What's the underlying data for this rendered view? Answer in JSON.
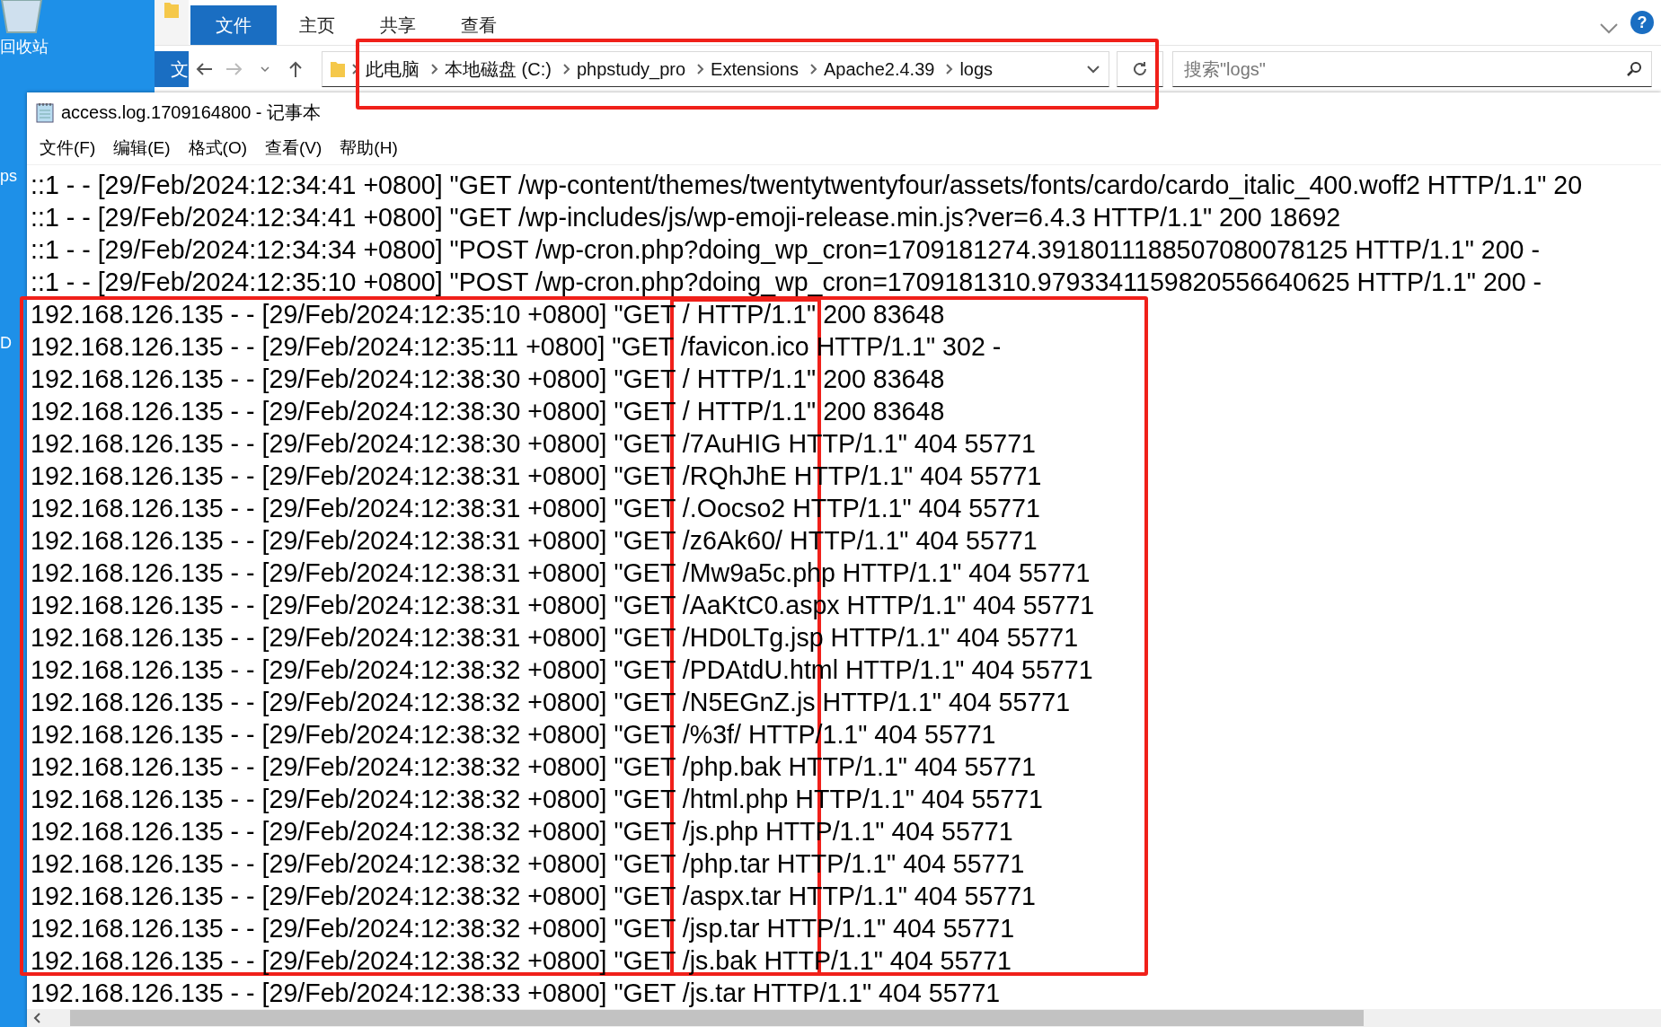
{
  "desktop": {
    "labels": [
      "回收站",
      "ps",
      "D"
    ]
  },
  "explorer": {
    "quick_access_label": "文",
    "ribbon_tabs": [
      {
        "label": "文件",
        "selected": true
      },
      {
        "label": "主页",
        "selected": false
      },
      {
        "label": "共享",
        "selected": false
      },
      {
        "label": "查看",
        "selected": false
      }
    ],
    "breadcrumb": [
      "此电脑",
      "本地磁盘 (C:)",
      "phpstudy_pro",
      "Extensions",
      "Apache2.4.39",
      "logs"
    ],
    "search": {
      "placeholder": "搜索\"logs\""
    },
    "help": "?"
  },
  "notepad": {
    "title": "access.log.1709164800 - 记事本",
    "menu": [
      "文件(F)",
      "编辑(E)",
      "格式(O)",
      "查看(V)",
      "帮助(H)"
    ],
    "lines": [
      "::1 - - [29/Feb/2024:12:34:41 +0800] \"GET /wp-content/themes/twentytwentyfour/assets/fonts/cardo/cardo_italic_400.woff2 HTTP/1.1\" 20",
      "::1 - - [29/Feb/2024:12:34:41 +0800] \"GET /wp-includes/js/wp-emoji-release.min.js?ver=6.4.3 HTTP/1.1\" 200 18692",
      "::1 - - [29/Feb/2024:12:34:34 +0800] \"POST /wp-cron.php?doing_wp_cron=1709181274.3918011188507080078125 HTTP/1.1\" 200 -",
      "::1 - - [29/Feb/2024:12:35:10 +0800] \"POST /wp-cron.php?doing_wp_cron=1709181310.9793341159820556640625 HTTP/1.1\" 200 -",
      "192.168.126.135 - - [29/Feb/2024:12:35:10 +0800] \"GET / HTTP/1.1\" 200 83648",
      "192.168.126.135 - - [29/Feb/2024:12:35:11 +0800] \"GET /favicon.ico HTTP/1.1\" 302 -",
      "192.168.126.135 - - [29/Feb/2024:12:38:30 +0800] \"GET / HTTP/1.1\" 200 83648",
      "192.168.126.135 - - [29/Feb/2024:12:38:30 +0800] \"GET / HTTP/1.1\" 200 83648",
      "192.168.126.135 - - [29/Feb/2024:12:38:30 +0800] \"GET /7AuHIG HTTP/1.1\" 404 55771",
      "192.168.126.135 - - [29/Feb/2024:12:38:31 +0800] \"GET /RQhJhE HTTP/1.1\" 404 55771",
      "192.168.126.135 - - [29/Feb/2024:12:38:31 +0800] \"GET /.Oocso2 HTTP/1.1\" 404 55771",
      "192.168.126.135 - - [29/Feb/2024:12:38:31 +0800] \"GET /z6Ak60/ HTTP/1.1\" 404 55771",
      "192.168.126.135 - - [29/Feb/2024:12:38:31 +0800] \"GET /Mw9a5c.php HTTP/1.1\" 404 55771",
      "192.168.126.135 - - [29/Feb/2024:12:38:31 +0800] \"GET /AaKtC0.aspx HTTP/1.1\" 404 55771",
      "192.168.126.135 - - [29/Feb/2024:12:38:31 +0800] \"GET /HD0LTg.jsp HTTP/1.1\" 404 55771",
      "192.168.126.135 - - [29/Feb/2024:12:38:32 +0800] \"GET /PDAtdU.html HTTP/1.1\" 404 55771",
      "192.168.126.135 - - [29/Feb/2024:12:38:32 +0800] \"GET /N5EGnZ.js HTTP/1.1\" 404 55771",
      "192.168.126.135 - - [29/Feb/2024:12:38:32 +0800] \"GET /%3f/ HTTP/1.1\" 404 55771",
      "192.168.126.135 - - [29/Feb/2024:12:38:32 +0800] \"GET /php.bak HTTP/1.1\" 404 55771",
      "192.168.126.135 - - [29/Feb/2024:12:38:32 +0800] \"GET /html.php HTTP/1.1\" 404 55771",
      "192.168.126.135 - - [29/Feb/2024:12:38:32 +0800] \"GET /js.php HTTP/1.1\" 404 55771",
      "192.168.126.135 - - [29/Feb/2024:12:38:32 +0800] \"GET /php.tar HTTP/1.1\" 404 55771",
      "192.168.126.135 - - [29/Feb/2024:12:38:32 +0800] \"GET /aspx.tar HTTP/1.1\" 404 55771",
      "192.168.126.135 - - [29/Feb/2024:12:38:32 +0800] \"GET /jsp.tar HTTP/1.1\" 404 55771",
      "192.168.126.135 - - [29/Feb/2024:12:38:32 +0800] \"GET /js.bak HTTP/1.1\" 404 55771",
      "192.168.126.135 - - [29/Feb/2024:12:38:33 +0800] \"GET /js.tar HTTP/1.1\" 404 55771"
    ]
  }
}
